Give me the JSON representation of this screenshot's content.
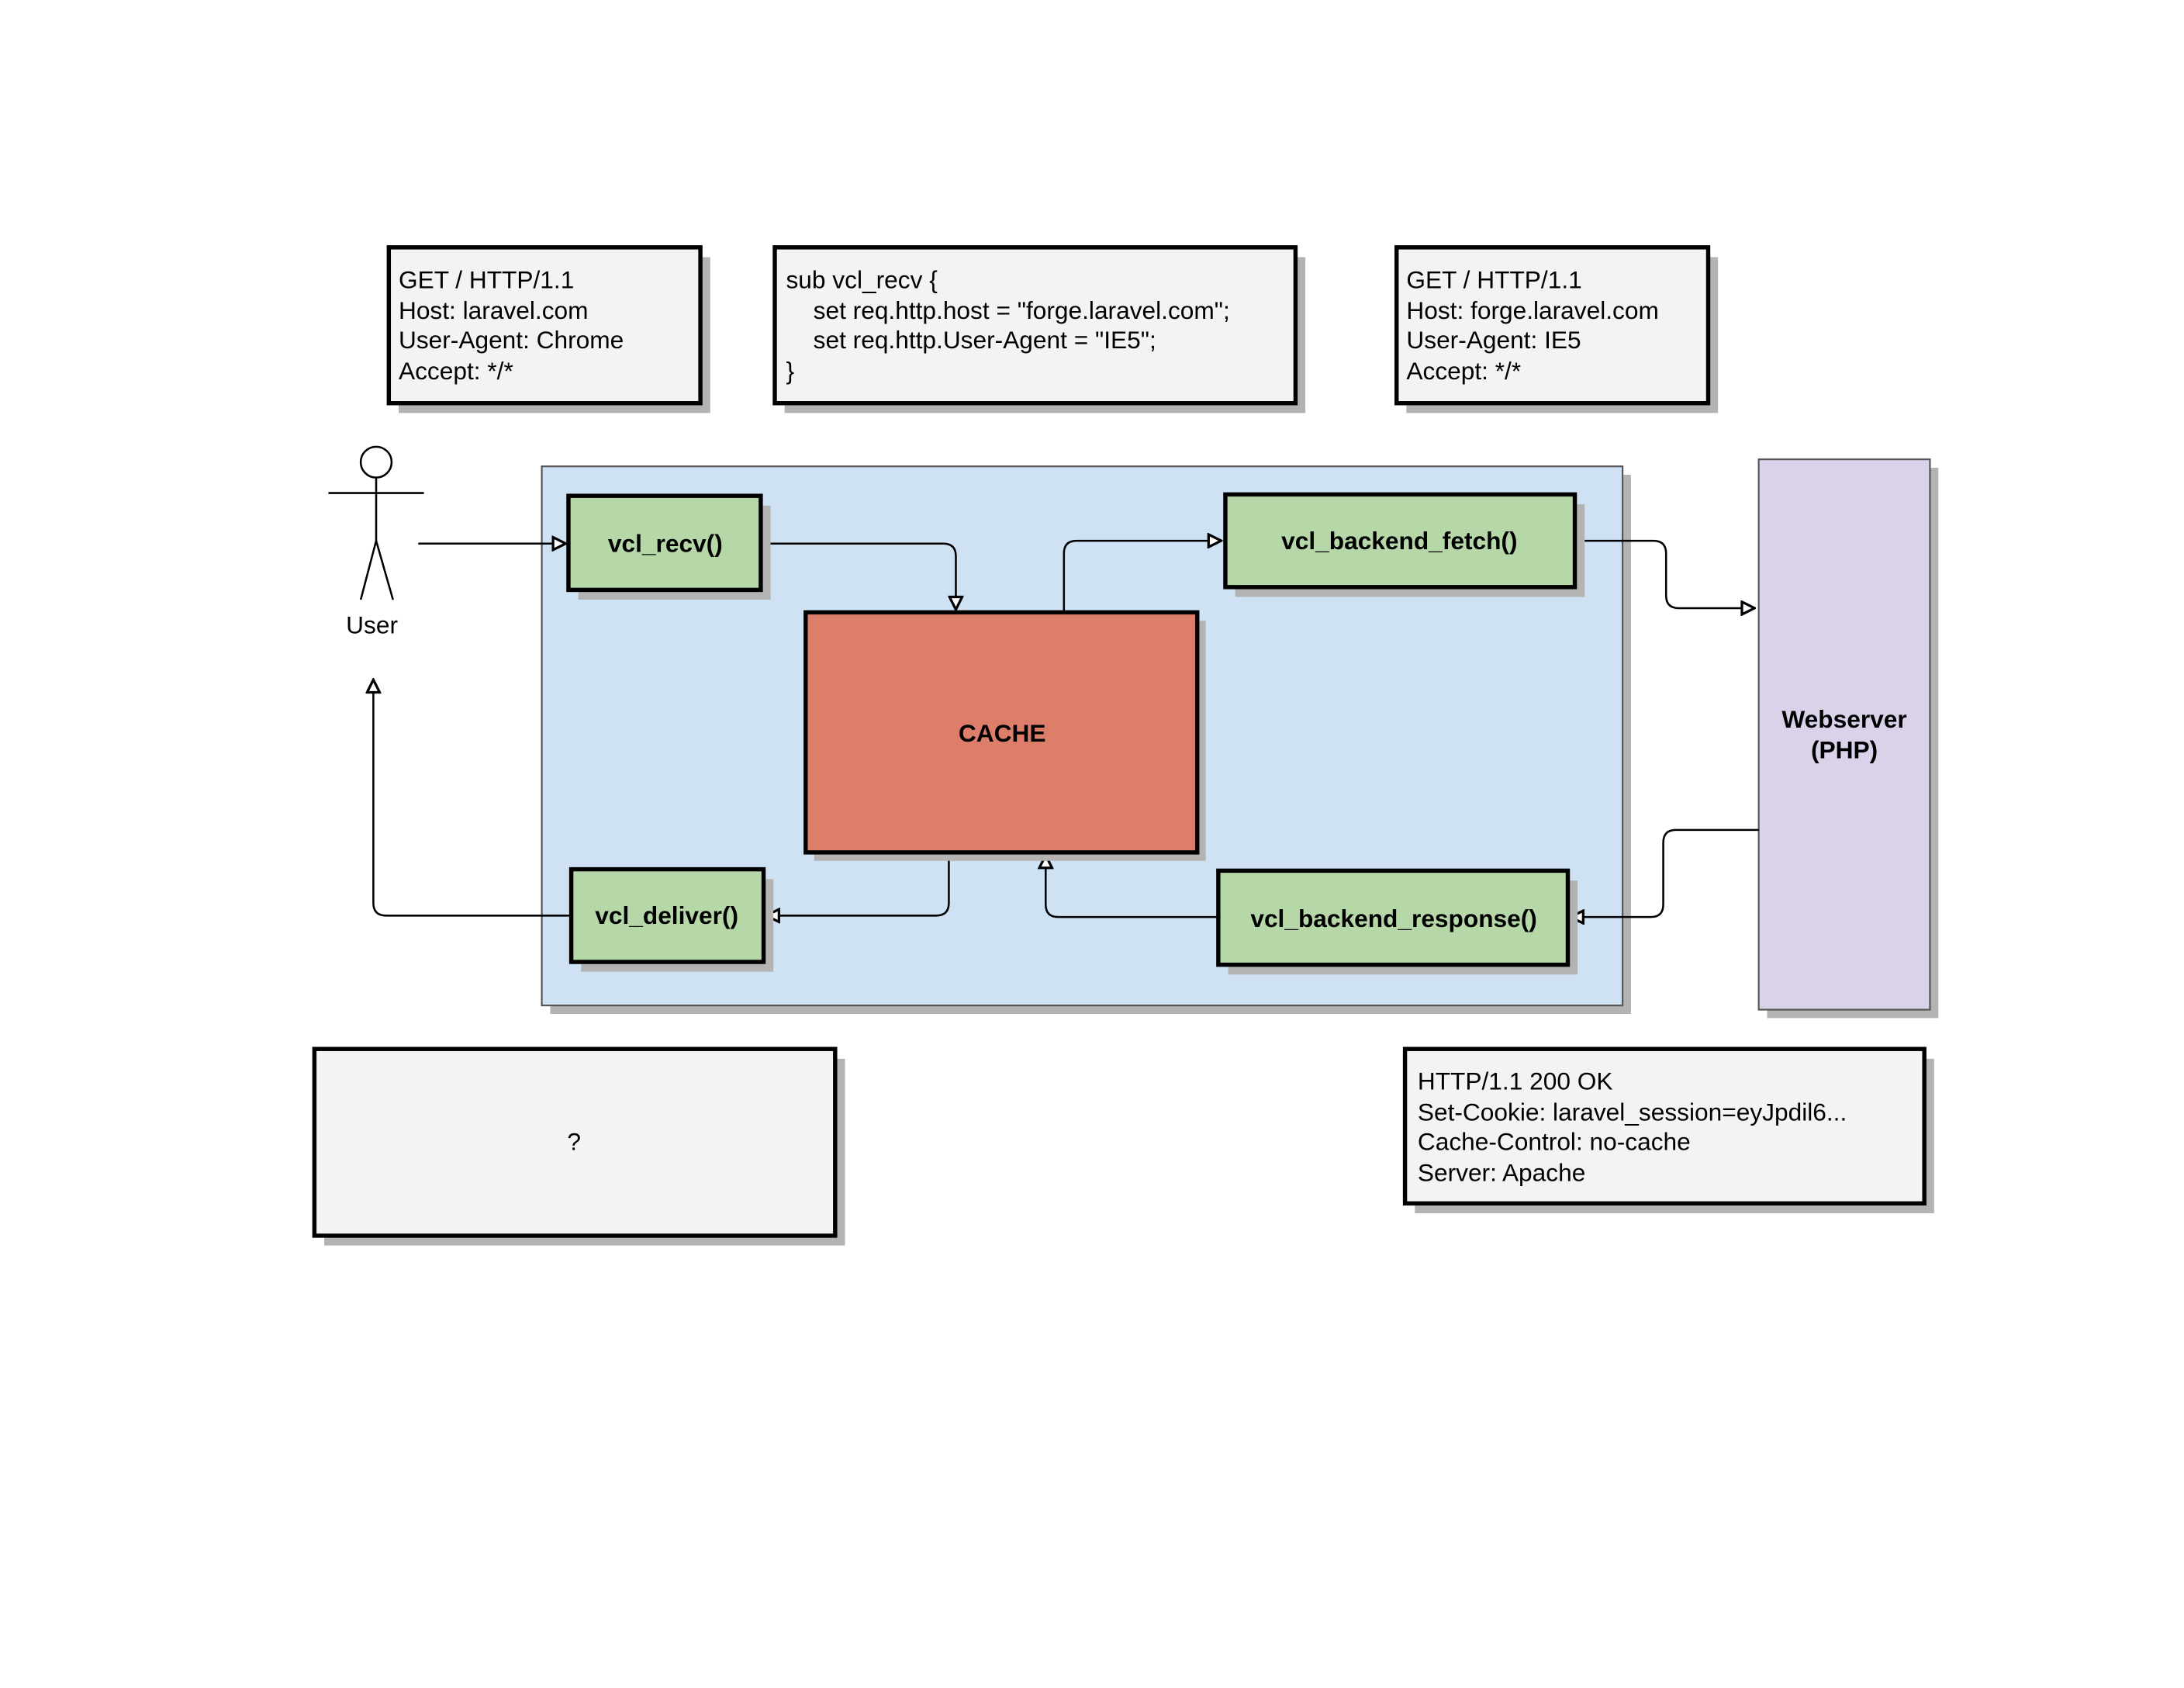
{
  "notes": {
    "client_request": [
      "GET / HTTP/1.1",
      "Host: laravel.com",
      "User-Agent: Chrome",
      "Accept: */*"
    ],
    "vcl_code": [
      "sub vcl_recv {",
      "    set req.http.host = \"forge.laravel.com\";",
      "    set req.http.User-Agent = \"IE5\";",
      "}"
    ],
    "backend_request": [
      "GET / HTTP/1.1",
      "Host: forge.laravel.com",
      "User-Agent: IE5",
      "Accept: */*"
    ],
    "backend_response": [
      "HTTP/1.1 200 OK",
      "Set-Cookie: laravel_session=eyJpdil6...",
      "Cache-Control: no-cache",
      "Server: Apache"
    ],
    "client_response": "?"
  },
  "actor": {
    "label": "User"
  },
  "nodes": {
    "vcl_recv": "vcl_recv()",
    "vcl_backend_fetch": "vcl_backend_fetch()",
    "cache": "CACHE",
    "vcl_deliver": "vcl_deliver()",
    "vcl_backend_response": "vcl_backend_response()",
    "webserver": [
      "Webserver",
      "(PHP)"
    ]
  },
  "colors": {
    "container": "#cfe2f3",
    "function_node": "#b6d7a8",
    "cache": "#dd7e6b",
    "webserver": "#d9d2e9",
    "note": "#f3f3f3",
    "shadow": "#b3b3b3"
  }
}
